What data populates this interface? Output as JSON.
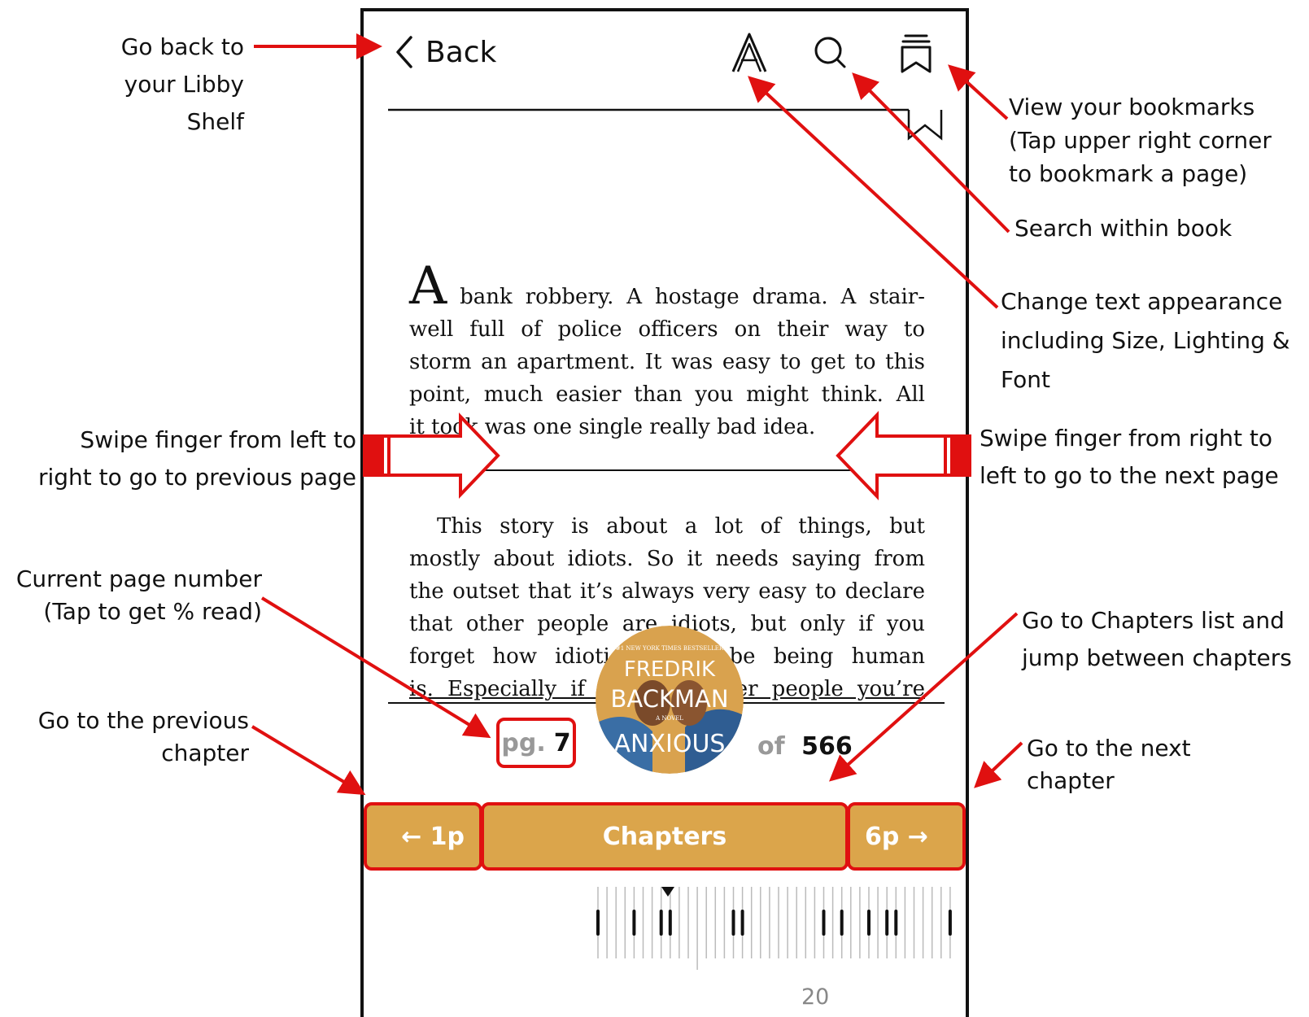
{
  "reader": {
    "back_label": "Back",
    "paragraph1_dropcap": "A",
    "paragraph1_lines": [
      "bank robbery. A hostage drama. A stair-",
      "well full of police officers on their way to",
      "storm an apartment. It was easy to get to this",
      "point, much easier than you might think. All",
      "it took was one single really bad idea."
    ],
    "paragraph2_lines": [
      "This story is about a lot of things, but",
      "mostly about idiots. So it needs saying from",
      "the outset that it’s always very easy to declare",
      "that other people are idiots, but only if you",
      "forget how idiotic it can be being human",
      "is. Especially if you are other people you’re"
    ],
    "page_prefix": "pg.",
    "page_current": "7",
    "page_of": "of",
    "page_total": "566",
    "prev_chapter_label": "← 1p",
    "chapters_label": "Chapters",
    "next_chapter_label": "6p →",
    "scrubber_number": "20",
    "cover": {
      "top_text": "#1 NEW YORK TIMES BESTSELLER",
      "author_line1": "FREDRIK",
      "author_line2": "BACKMAN",
      "novel": "A NOVEL",
      "title": "ANXIOUS"
    }
  },
  "annotations": {
    "back": [
      "Go back to",
      "your Libby",
      "Shelf"
    ],
    "bookmarks": [
      "View your bookmarks",
      "(Tap upper right corner",
      "to bookmark a page)"
    ],
    "search": [
      "Search within book"
    ],
    "appearance": [
      "Change text appearance",
      "including Size, Lighting &",
      "Font"
    ],
    "swipe_prev": [
      "Swipe finger from left to",
      "right to go to previous page"
    ],
    "swipe_next": [
      "Swipe finger from right to",
      "left to go to the next page"
    ],
    "page_number": [
      "Current page number",
      "(Tap to get % read)"
    ],
    "chapters": [
      "Go to Chapters list and",
      "jump between chapters"
    ],
    "prev_chapter": [
      "Go to the previous",
      "chapter"
    ],
    "next_chapter": [
      "Go to the next",
      "chapter"
    ]
  },
  "colors": {
    "accent_gold": "#dba54b",
    "annotation_red": "#e01010"
  },
  "icons": [
    "back-chevron-icon",
    "text-appearance-icon",
    "search-icon",
    "bookmarks-icon",
    "bookmark-corner-icon"
  ]
}
